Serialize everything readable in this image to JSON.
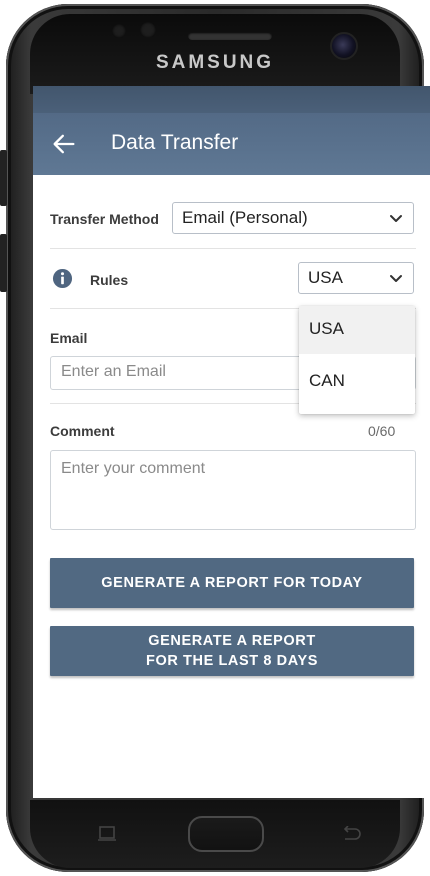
{
  "device": {
    "brand": "SAMSUNG"
  },
  "appbar": {
    "title": "Data Transfer",
    "back_icon": "arrow-left-icon"
  },
  "form": {
    "transfer_method": {
      "label": "Transfer Method",
      "value": "Email (Personal)"
    },
    "rules": {
      "label": "Rules",
      "value": "USA",
      "info_icon": "info-circle-icon"
    },
    "email": {
      "label": "Email",
      "placeholder": "Enter an Email"
    },
    "comment": {
      "label": "Comment",
      "counter": "0/60",
      "placeholder": "Enter your comment"
    }
  },
  "dropdown": {
    "options": [
      "USA",
      "CAN"
    ],
    "highlighted": "USA"
  },
  "buttons": {
    "today": "GENERATE A REPORT FOR TODAY",
    "last8_line1": "GENERATE A REPORT",
    "last8_line2": "FOR THE LAST 8 DAYS"
  },
  "colors": {
    "appbar": "#5b7390",
    "button": "#516982",
    "info_icon": "#4f6580"
  }
}
